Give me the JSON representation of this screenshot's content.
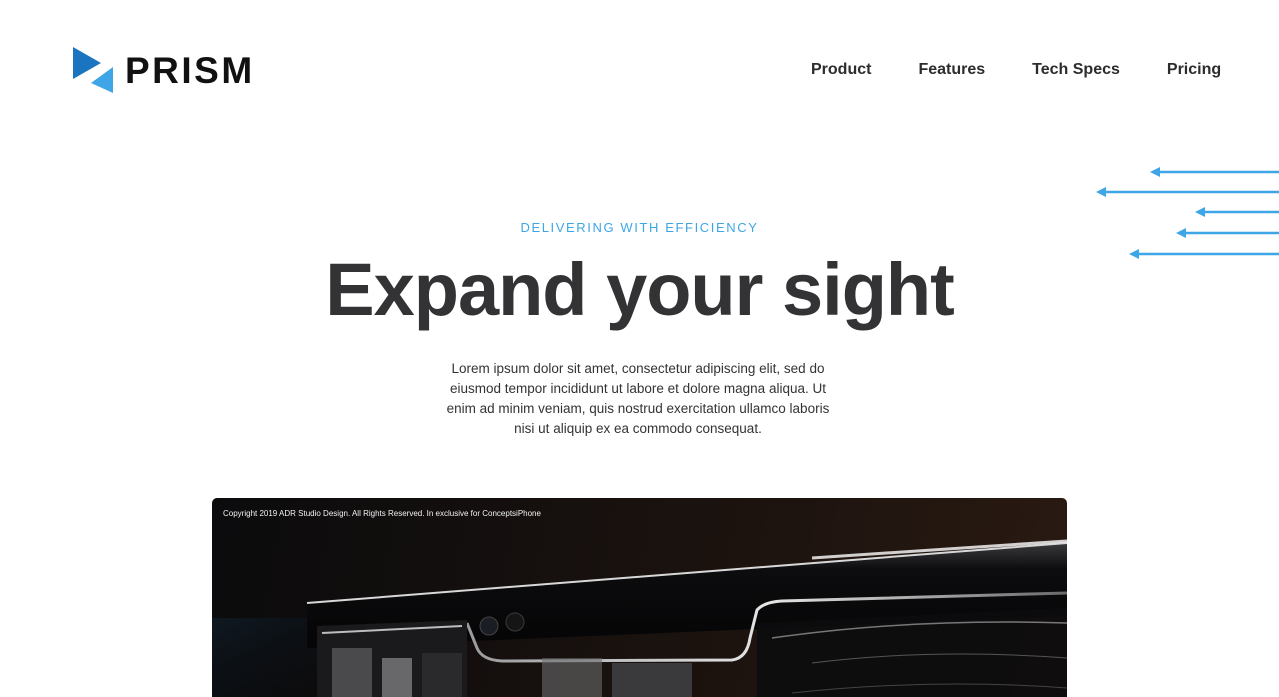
{
  "brand": {
    "name": "PRISM",
    "logo_icon": "prism-triangles-icon",
    "colors": {
      "primary": "#1b74c0",
      "light": "#3ea6e6"
    }
  },
  "nav": {
    "items": [
      {
        "label": "Product"
      },
      {
        "label": "Features"
      },
      {
        "label": "Tech Specs"
      },
      {
        "label": "Pricing"
      }
    ]
  },
  "decor": {
    "icon": "arrow-left-icon",
    "color": "#3ea6e6",
    "count": 5
  },
  "hero": {
    "eyebrow": "DELIVERING WITH EFFICIENCY",
    "headline": "Expand your sight",
    "lede": "Lorem ipsum dolor sit amet, consectetur adipiscing elit, sed do eiusmod tempor incididunt ut labore et dolore magna aliqua. Ut enim ad minim veniam, quis nostrud exercitation ullamco laboris nisi ut aliquip ex ea commodo consequat.",
    "accent_color": "#3ea6e6"
  },
  "media": {
    "image": "smart-glasses-photo",
    "copyright": "Copyright 2019 ADR Studio Design. All Rights Reserved. In exclusive for ConceptsiPhone"
  }
}
